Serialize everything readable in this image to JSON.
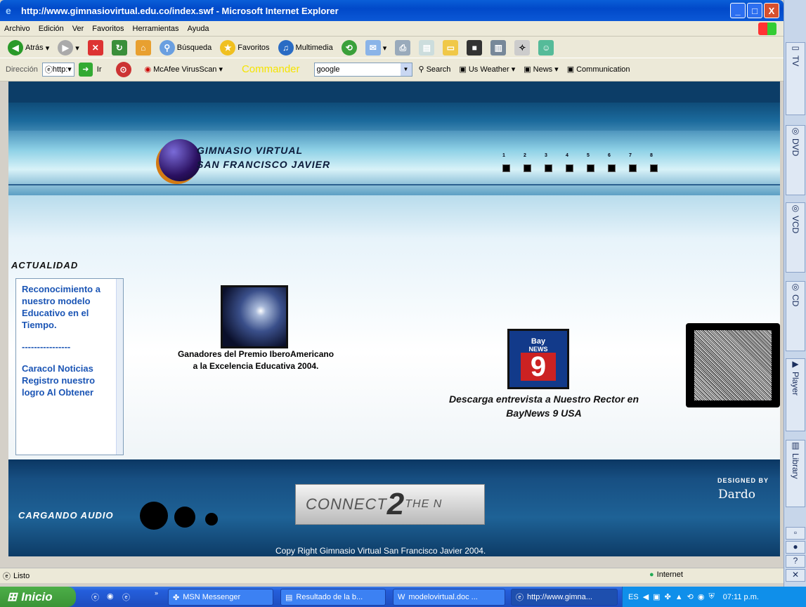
{
  "window": {
    "title": "http://www.gimnasiovirtual.edu.co/index.swf - Microsoft Internet Explorer",
    "minimize": "_",
    "maximize": "□",
    "close": "X"
  },
  "menu": [
    "Archivo",
    "Edición",
    "Ver",
    "Favoritos",
    "Herramientas",
    "Ayuda"
  ],
  "toolbar": {
    "back": "Atrás",
    "search": "Búsqueda",
    "favorites": "Favoritos",
    "media": "Multimedia"
  },
  "addressbar": {
    "label": "Dirección",
    "value": "http:",
    "go": "Ir",
    "mcafee": "McAfee VirusScan",
    "commander": "Commander",
    "search_value": "google",
    "search_btn": "Search",
    "links": [
      "Us Weather",
      "News",
      "Communication"
    ]
  },
  "site": {
    "title1": "GIMNASIO VIRTUAL",
    "title2": "SAN FRANCISCO JAVIER",
    "nav_numbers": [
      "1",
      "2",
      "3",
      "4",
      "5",
      "6",
      "7",
      "8"
    ],
    "actualidad": "ACTUALIDAD",
    "news": [
      "Reconocimiento a nuestro modelo Educativo en el Tiempo.",
      "----------------",
      "Caracol Noticias Registro nuestro logro Al Obtener"
    ],
    "caption1": "Ganadores del Premio IberoAmericano a la Excelencia Educativa 2004.",
    "baynews_top": "Bay",
    "baynews_mid": "NEWS",
    "baynews_num": "9",
    "caption2": "Descarga entrevista a Nuestro Rector en BayNews 9 USA",
    "cargando": "CARGANDO AUDIO",
    "connect": "CONNECT",
    "connect_two": "2",
    "connect_small": "THE N",
    "designed_by": "DESIGNED BY",
    "dardo": "Dardo",
    "copyright": "Copy Right Gimnasio Virtual San Francisco Javier 2004."
  },
  "status": {
    "text": "Listo",
    "zone": "Internet"
  },
  "taskbar": {
    "start": "Inicio",
    "tasks": [
      "MSN Messenger",
      "Resultado de la b...",
      "modelovirtual.doc ...",
      "http://www.gimna..."
    ],
    "lang": "ES",
    "clock": "07:11 p.m."
  },
  "sidepanel": [
    "TV",
    "DVD",
    "VCD",
    "CD",
    "Player",
    "Library"
  ]
}
